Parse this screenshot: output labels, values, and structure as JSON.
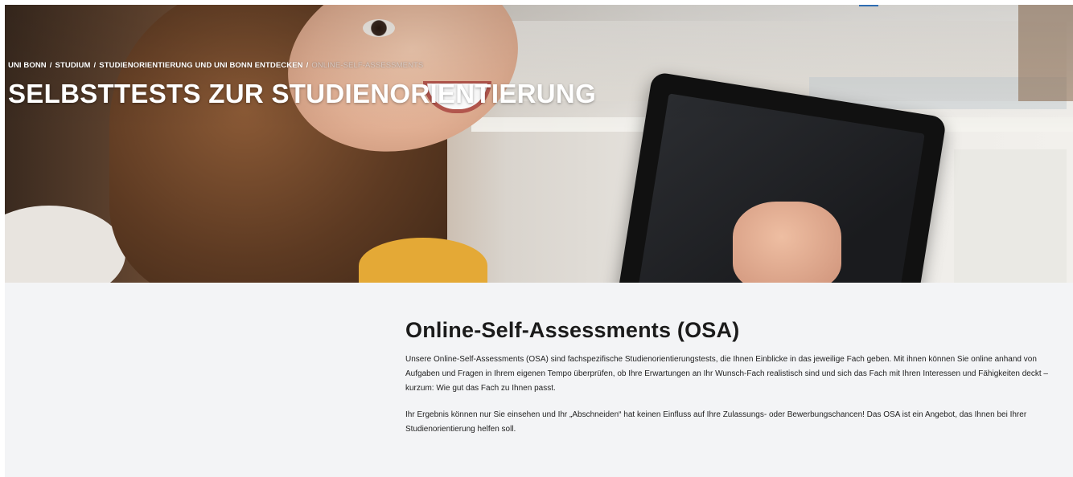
{
  "breadcrumb": {
    "items": [
      "Uni Bonn",
      "Studium",
      "Studienorientierung und Uni Bonn entdecken"
    ],
    "current": "Online-Self-Assessments",
    "separator": "/"
  },
  "hero": {
    "title": "Selbsttests zur Studienorientierung"
  },
  "main": {
    "heading": "Online-Self-Assessments (OSA)",
    "paragraphs": [
      "Unsere Online-Self-Assessments (OSA) sind fachspezifische Studienorientierungstests, die Ihnen Einblicke in das jeweilige Fach geben. Mit ihnen können Sie online anhand von Aufgaben und Fragen in Ihrem eigenen Tempo überprüfen, ob Ihre Erwartungen an Ihr Wunsch-Fach realistisch sind und sich das Fach mit Ihren Interessen und Fähigkeiten deckt – kurzum: Wie gut das Fach zu Ihnen passt.",
      "Ihr Ergebnis können nur Sie einsehen und Ihr „Abschneiden“ hat keinen Einfluss auf Ihre Zulassungs- oder Bewerbungschancen! Das OSA ist ein Angebot, das Ihnen bei Ihrer Studienorientierung helfen soll."
    ]
  },
  "colors": {
    "accent": "#2e6db3",
    "content_bg": "#f3f4f6",
    "heading": "#1b1b1b"
  }
}
